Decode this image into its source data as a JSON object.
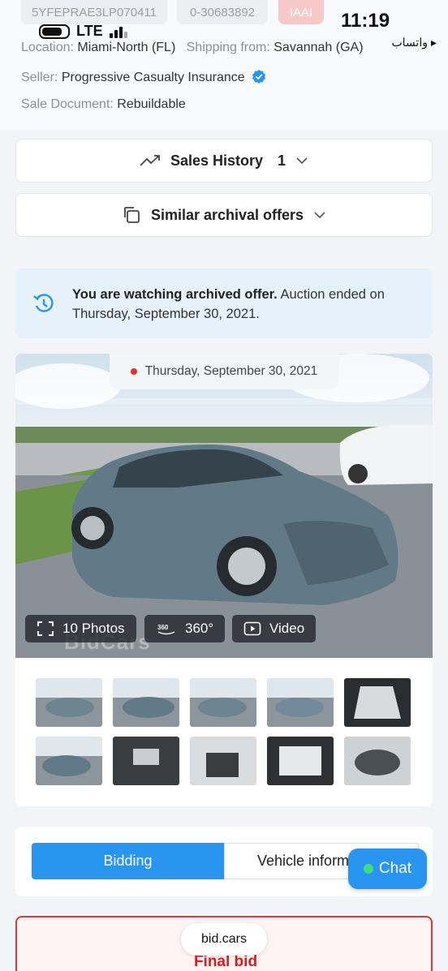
{
  "header_chips": {
    "vin": "5YFEPRAE3LP070411",
    "lot": "0-30683892",
    "auction": "IAAI"
  },
  "status_bar": {
    "network": "LTE",
    "time": "11:19",
    "back_app": "واتساب"
  },
  "details": {
    "location_label": "Location:",
    "location_value": "Miami-North (FL)",
    "shipping_label": "Shipping from:",
    "shipping_value": "Savannah (GA)",
    "seller_label": "Seller:",
    "seller_value": "Progressive Casualty Insurance",
    "sale_doc_label": "Sale Document:",
    "sale_doc_value": "Rebuildable"
  },
  "sales_history": {
    "label": "Sales History",
    "count": "1"
  },
  "similar_offers": {
    "label": "Similar archival offers"
  },
  "notice": {
    "bold": "You are watching archived offer.",
    "text": " Auction ended on Thursday, September 30, 2021."
  },
  "gallery": {
    "date": "Thursday, September 30, 2021",
    "photos_label": "10 Photos",
    "view360_label": "360°",
    "video_label": "Video",
    "watermark": "BidCars"
  },
  "tabs": {
    "bidding": "Bidding",
    "vehicle_info": "Vehicle inform"
  },
  "chat": {
    "label": "Chat"
  },
  "footer": {
    "site": "bid.cars",
    "final_bid": "Final bid"
  },
  "colors": {
    "accent": "#2a95f0",
    "danger": "#d73a3a",
    "notice_bg": "#e5f1fb"
  }
}
